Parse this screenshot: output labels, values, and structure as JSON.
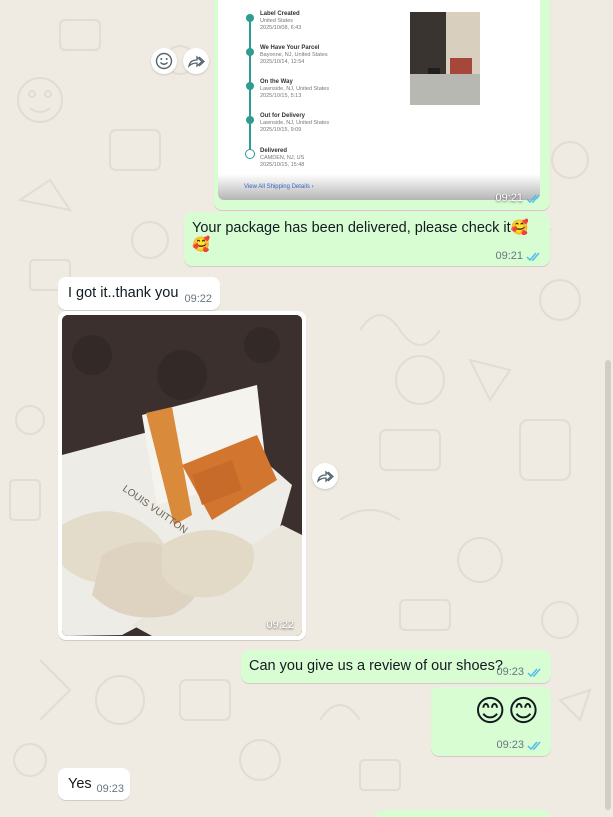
{
  "chat": {
    "tracking_card": {
      "steps": [
        {
          "title": "Label Created",
          "place": "United States",
          "date": "2025/10/08, 6:43"
        },
        {
          "title": "We Have Your Parcel",
          "place": "Bayonne, NJ, United States",
          "date": "2025/10/14, 12:54"
        },
        {
          "title": "On the Way",
          "place": "Lawnside, NJ, United States",
          "date": "2025/10/15, 5:13"
        },
        {
          "title": "Out for Delivery",
          "place": "Lawnside, NJ, United States",
          "date": "2025/10/15, 9:09"
        },
        {
          "title": "Delivered",
          "place": "CAMDEN, NJ, US",
          "date": "2025/10/15, 15:48"
        }
      ],
      "view_all_label": "View All Shipping Details",
      "time": "09:21"
    },
    "messages": [
      {
        "text": "Your package has been delivered, please check it",
        "emoji": "🥰🥰",
        "time": "09:21"
      },
      {
        "text": "I got it..thank you",
        "time": "09:22"
      },
      {
        "photo_time": "09:22",
        "box_text": "LOUIS VUITTON"
      },
      {
        "text": "Can you give us a review of our shoes?",
        "time": "09:23"
      },
      {
        "emoji": "😊😊",
        "time": "09:23"
      },
      {
        "text": "Yes",
        "time": "09:23"
      }
    ]
  },
  "icons": {
    "emoji_react": "smiley-face-icon",
    "forward": "forward-arrow-icon",
    "read_receipt": "double-check-icon"
  },
  "colors": {
    "outgoing_bubble": "#d9fdd3",
    "incoming_bubble": "#ffffff",
    "read_tick": "#53bdeb",
    "background": "#efeae2"
  }
}
